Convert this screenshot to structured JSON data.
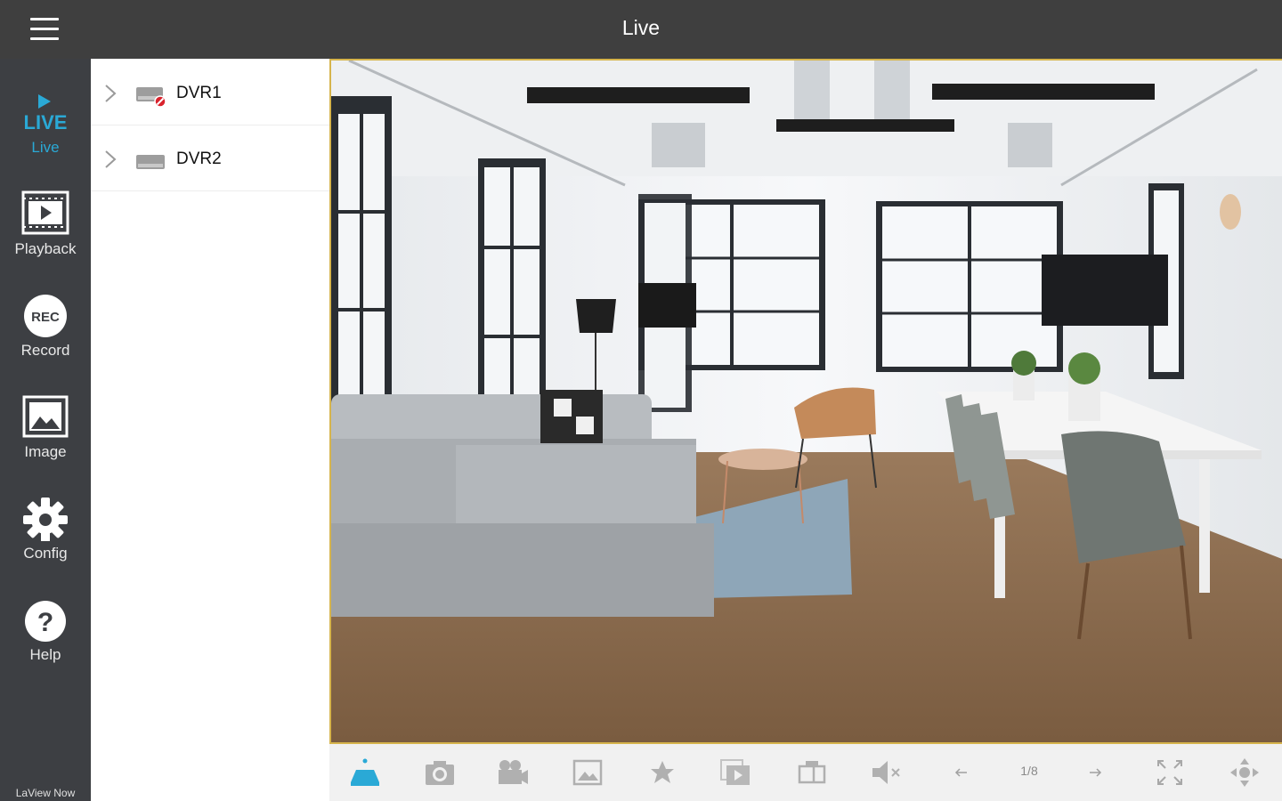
{
  "header": {
    "title": "Live"
  },
  "sidebar": {
    "live_logo": "LIVE",
    "items": [
      {
        "label": "Live"
      },
      {
        "label": "Playback"
      },
      {
        "label": "Record",
        "icon_text": "REC"
      },
      {
        "label": "Image"
      },
      {
        "label": "Config"
      },
      {
        "label": "Help",
        "icon_text": "?"
      }
    ],
    "brand": "LaView Now"
  },
  "devices": [
    {
      "name": "DVR1",
      "status": "offline-error"
    },
    {
      "name": "DVR2",
      "status": "normal"
    }
  ],
  "toolbar": {
    "page_indicator": "1/8"
  },
  "colors": {
    "topbar": "#3f3f3f",
    "sidebar": "#3d3f43",
    "accent": "#2aa9d6",
    "video_border": "#d6b44c",
    "error": "#d9232d"
  }
}
